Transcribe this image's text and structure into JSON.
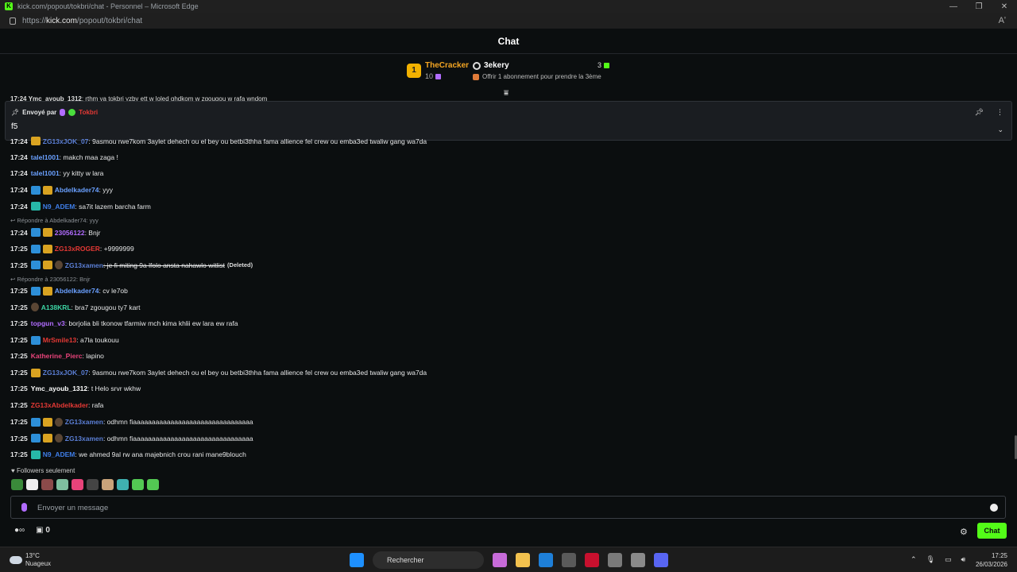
{
  "browser": {
    "window_title": "kick.com/popout/tokbri/chat - Personnel – Microsoft Edge",
    "url_prefix": "https://",
    "url_host": "kick.com",
    "url_path": "/popout/tokbri/chat",
    "reader_icon": "Aʹ"
  },
  "header": {
    "title": "Chat"
  },
  "leaderboard": {
    "rank": "1",
    "top1_name": "TheCracker",
    "top1_gifts": "10",
    "top2_name": "3ekery",
    "top2_count": "3",
    "offer_text": "Offrir 1 abonnement pour prendre la 3ème"
  },
  "peek_line": {
    "time": "17:24",
    "user": "Ymc_ayoub_1312",
    "text": ": rthm ya tokbri yzby ett w loled ghdkom w zgougou w rafa wndom"
  },
  "pinned": {
    "sent_by_label": "Envoyé par",
    "author": "Tokbri",
    "message": "f5"
  },
  "messages": [
    {
      "time": "17:24",
      "user": "ZG13xJOK_07",
      "user_color": "#5b7fd6",
      "badges": [
        "gold"
      ],
      "text": ": 9asmou rwe7kom 3aylet dehech ou el bey ou betbi3thha fama allience fel crew ou emba3ed twaliw gang wa7da"
    },
    {
      "time": "17:24",
      "user": "talel1001",
      "user_color": "#6aa0ff",
      "badges": [],
      "text": ": makch maa zaga !"
    },
    {
      "time": "17:24",
      "user": "talel1001",
      "user_color": "#6aa0ff",
      "badges": [],
      "text": ": yy kitty w lara"
    },
    {
      "time": "17:24",
      "user": "Abdelkader74",
      "user_color": "#6aa0ff",
      "badges": [
        "blue",
        "gold"
      ],
      "text": ": yyy"
    },
    {
      "time": "17:24",
      "user": "N9_ADEM",
      "user_color": "#3f7ee8",
      "badges": [
        "teal"
      ],
      "text": ": sa7it lazem barcha farm"
    },
    {
      "time": "17:24",
      "user": "23056122",
      "user_color": "#b16cff",
      "badges": [
        "blue",
        "gold"
      ],
      "text": ": Bnjr",
      "reply": "Répondre à Abdelkader74: yyy"
    },
    {
      "time": "17:25",
      "user": "ZG13xROGER",
      "user_color": "#e53935",
      "badges": [
        "blue",
        "gold"
      ],
      "text": ": +9999999"
    },
    {
      "time": "17:25",
      "user": "ZG13xamen",
      "user_color": "#5b7fd6",
      "badges": [
        "blue",
        "gold",
        "char"
      ],
      "text": ": je fi miting 9a lfolo ansta nahawlo witlist",
      "deleted": true,
      "deleted_note": "(Deleted)"
    },
    {
      "time": "17:25",
      "user": "Abdelkader74",
      "user_color": "#6aa0ff",
      "badges": [
        "blue",
        "gold"
      ],
      "text": ": cv le7ob",
      "reply": "Répondre à 23056122: Bnjr"
    },
    {
      "time": "17:25",
      "user": "A138KRL",
      "user_color": "#3dd6a5",
      "badges": [
        "char"
      ],
      "text": ": bra7 zgougou ty7 kart"
    },
    {
      "time": "17:25",
      "user": "topgun_v3",
      "user_color": "#b16cff",
      "badges": [],
      "text": ": borjolia bli tkonow tfarmiw mch kima khlii ew lara ew rafa"
    },
    {
      "time": "17:25",
      "user": "MrSmile13",
      "user_color": "#e53935",
      "badges": [
        "blue"
      ],
      "text": ": a7la toukouu"
    },
    {
      "time": "17:25",
      "user": "Katherine_Pierc",
      "user_color": "#e8437a",
      "badges": [],
      "text": ": lapino"
    },
    {
      "time": "17:25",
      "user": "ZG13xJOK_07",
      "user_color": "#5b7fd6",
      "badges": [
        "gold"
      ],
      "text": ": 9asmou rwe7kom 3aylet dehech ou el bey ou betbi3thha fama allience fel crew ou emba3ed twaliw gang wa7da"
    },
    {
      "time": "17:25",
      "user": "Ymc_ayoub_1312",
      "user_color": "#ffffff",
      "badges": [],
      "text": ": t Helo srvr wkhw"
    },
    {
      "time": "17:25",
      "user": "ZG13xAbdelkader",
      "user_color": "#e53935",
      "badges": [],
      "text": ": rafa"
    },
    {
      "time": "17:25",
      "user": "ZG13xamen",
      "user_color": "#5b7fd6",
      "badges": [
        "blue",
        "gold",
        "char"
      ],
      "text": ": odhmn fiaaaaaaaaaaaaaaaaaaaaaaaaaaaaaaaa"
    },
    {
      "time": "17:25",
      "user": "ZG13xamen",
      "user_color": "#5b7fd6",
      "badges": [
        "blue",
        "gold",
        "char"
      ],
      "text": ": odhmn fiaaaaaaaaaaaaaaaaaaaaaaaaaaaaaaaa"
    },
    {
      "time": "17:25",
      "user": "N9_ADEM",
      "user_color": "#3f7ee8",
      "badges": [
        "teal"
      ],
      "text": ": we ahmed 9al rw ana majebnich crou rani mane9blouch"
    }
  ],
  "followers_only": "Followers seulement",
  "emote_colors": [
    "#3a8a3a",
    "#eeeeee",
    "#8b4a4a",
    "#7fbf9f",
    "#e8437a",
    "#444444",
    "#c9a37a",
    "#3fb0b0",
    "#53c853",
    "#53c853"
  ],
  "input": {
    "placeholder": "Envoyer un message"
  },
  "bottom": {
    "gift_count": "0",
    "chat_button": "Chat"
  },
  "taskbar": {
    "temp": "13°C",
    "weather": "Nuageux",
    "search": "Rechercher",
    "time": "17:25",
    "date": "26/03/2026",
    "app_colors": [
      "#1e90ff",
      "#2d2d2d",
      "#c76bd9",
      "#f2c14e",
      "#1e7fd8",
      "#5a5a5a",
      "#c8102e",
      "#7a7a7a",
      "#8a8a8a",
      "#5865f2"
    ]
  }
}
